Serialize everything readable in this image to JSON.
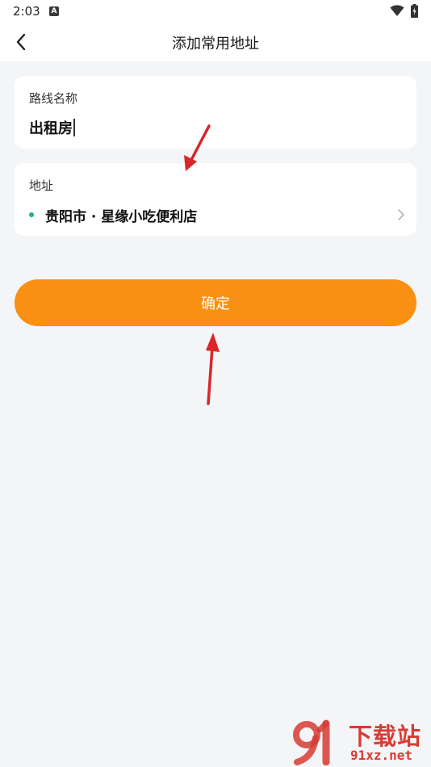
{
  "statusbar": {
    "time": "2:03",
    "notification_icon": "a-notification-icon",
    "wifi_icon": "wifi-icon",
    "battery_icon": "battery-charging-icon"
  },
  "header": {
    "title": "添加常用地址",
    "back_icon": "chevron-left-icon"
  },
  "route_card": {
    "label": "路线名称",
    "value": "出租房"
  },
  "address_card": {
    "label": "地址",
    "value": "贵阳市 · 星缘小吃便利店",
    "dot_color": "#12b886",
    "chevron_icon": "chevron-right-icon"
  },
  "confirm_button": {
    "label": "确定",
    "color": "#f99011"
  },
  "watermark": {
    "title": "下载站",
    "url": "91xz.net",
    "color": "#d63c34"
  }
}
